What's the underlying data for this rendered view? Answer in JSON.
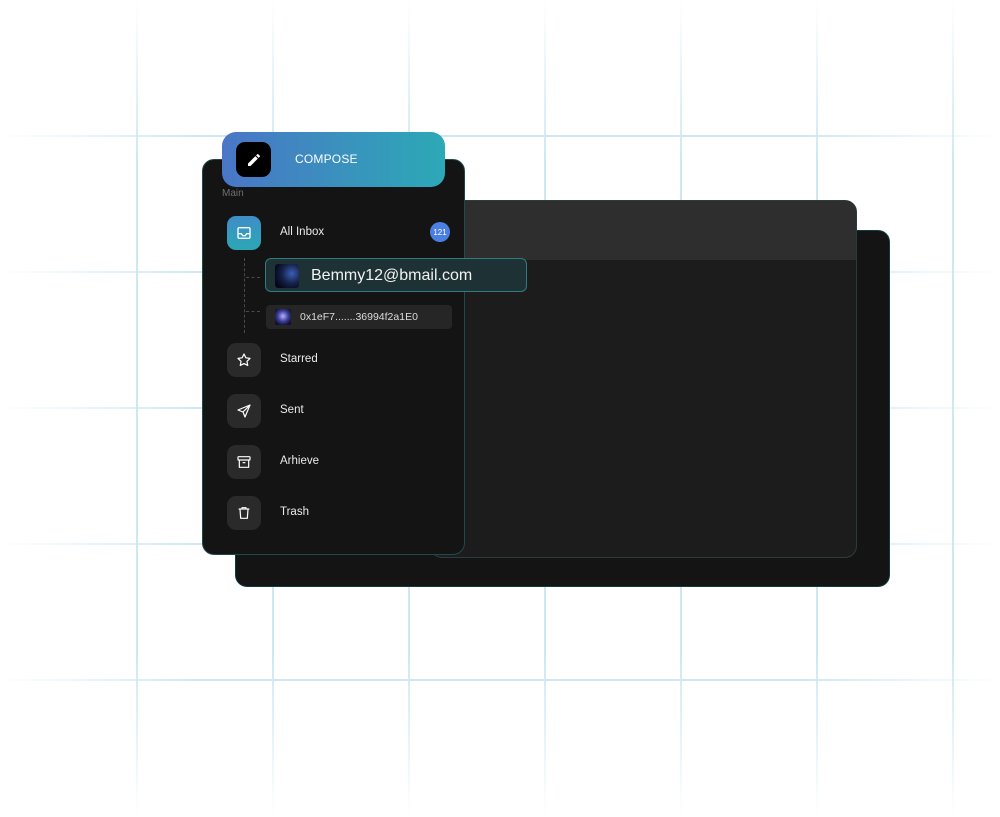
{
  "compose": {
    "label": "COMPOSE",
    "icon": "pencil-icon"
  },
  "sidebar": {
    "section_label": "Main",
    "items": [
      {
        "label": "All Inbox",
        "icon": "inbox-icon",
        "badge": "121",
        "active": true
      },
      {
        "label": "Starred",
        "icon": "star-icon"
      },
      {
        "label": "Sent",
        "icon": "send-icon"
      },
      {
        "label": "Arhieve",
        "icon": "archive-icon"
      },
      {
        "label": "Trash",
        "icon": "trash-icon"
      }
    ],
    "accounts": [
      {
        "label": "Bemmy12@bmail.com",
        "selected": true
      },
      {
        "label": "0x1eF7.......36994f2a1E0",
        "selected": false
      }
    ]
  },
  "colors": {
    "accent_gradient_start": "#4a76c6",
    "accent_gradient_end": "#2ca9b6",
    "badge": "#4b7fe0",
    "panel_dark": "#141414",
    "grid_line": "#cde8f3"
  }
}
